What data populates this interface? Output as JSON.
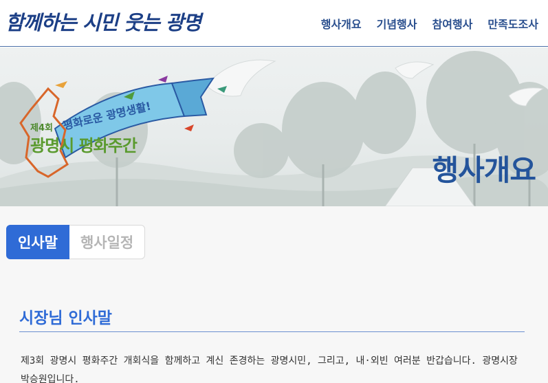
{
  "header": {
    "logo_text": "함께하는 시민 웃는 광명",
    "nav": [
      "행사개요",
      "기념행사",
      "참여행사",
      "만족도조사"
    ]
  },
  "banner": {
    "ribbon_text": "평화로운 광명생활!",
    "edition": "제4회",
    "event_name": "광명시 평화주간",
    "page_title": "행사개요"
  },
  "tabs": [
    {
      "label": "인사말",
      "active": true
    },
    {
      "label": "행사일정",
      "active": false
    }
  ],
  "section": {
    "title": "시장님 인사말",
    "greeting": "제3회 광명시 평화주간 개회식을 함께하고 계신 존경하는 광명시민, 그리고, 내·외빈 여러분 반갑습니다. 광명시장 박승원입니다."
  },
  "colors": {
    "brand_blue": "#2f6bd6",
    "title_blue": "#24549b",
    "nav_blue": "#2a4f8e",
    "event_green": "#5a9a2e",
    "map_orange": "#d8662a"
  }
}
